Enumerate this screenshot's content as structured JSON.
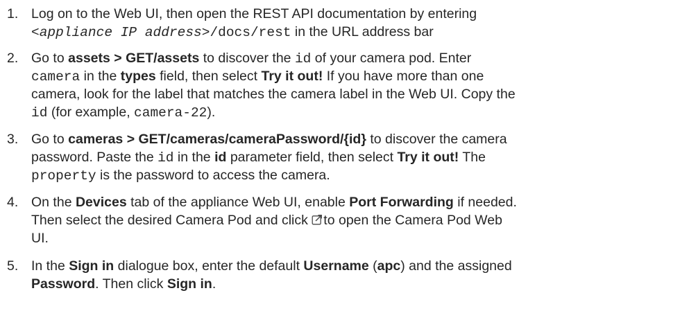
{
  "steps": [
    {
      "number": "1.",
      "line1": {
        "before": "Log on to the Web UI, then open the REST API documentation by entering"
      },
      "line2": {
        "placeholder": "<appliance IP address>",
        "path": "/docs/rest",
        "after": " in the URL address bar"
      }
    },
    {
      "number": "2.",
      "line1": {
        "t1": "Go to ",
        "b1": "assets > GET/assets",
        "t2": " to discover the ",
        "code1": "id",
        "t3": " of your camera pod. Enter"
      },
      "line2": {
        "code1": "camera",
        "t1": " in the ",
        "b1": "types",
        "t2": " field, then select ",
        "b2": "Try it out!",
        "t3": " If you have more than one"
      },
      "line3": {
        "t1": "camera, look for the label that matches the camera label in the Web UI. Copy the"
      },
      "line4": {
        "code1": "id",
        "t1": " (for example, ",
        "code2": "camera-22",
        "t2": ")."
      }
    },
    {
      "number": "3.",
      "line1": {
        "t1": "Go to ",
        "b1": "cameras > GET/cameras/cameraPassword/{id}",
        "t2": " to discover the camera"
      },
      "line2": {
        "t1": "password. Paste the ",
        "code1": "id",
        "t2": " in the ",
        "b1": "id",
        "t3": " parameter field, then select ",
        "b2": "Try it out!",
        "t4": " The"
      },
      "line3": {
        "code1": "property",
        "t1": " is the password to access the camera."
      }
    },
    {
      "number": "4.",
      "line1": {
        "t1": "On the ",
        "b1": "Devices",
        "t2": " tab of the appliance Web UI, enable ",
        "b2": "Port Forwarding",
        "t3": " if needed."
      },
      "line2": {
        "t1": "Then select the desired Camera Pod and click ",
        "icon": "external-link-icon",
        "t2": "to open the Camera Pod Web"
      },
      "line3": {
        "t1": "UI."
      }
    },
    {
      "number": "5.",
      "line1": {
        "t1": "In the ",
        "b1": "Sign in",
        "t2": " dialogue box, enter the default ",
        "b2": "Username",
        "t3": " (",
        "b3": "apc",
        "t4": ") and the assigned"
      },
      "line2": {
        "b1": "Password",
        "t1": ". Then click ",
        "b2": "Sign in",
        "t2": "."
      }
    }
  ],
  "colors": {
    "text": "#262626",
    "icon": "#4a4a4a"
  }
}
